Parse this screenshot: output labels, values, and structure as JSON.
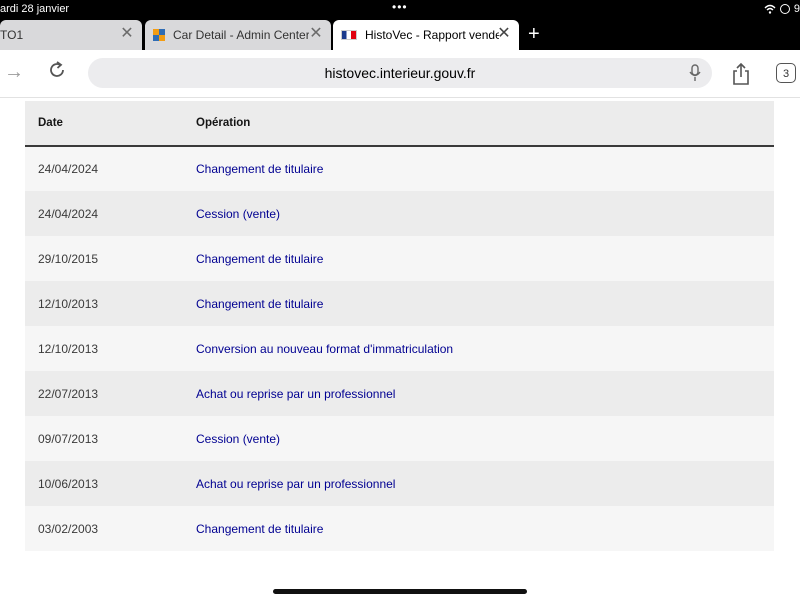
{
  "status": {
    "date": "ardi 28 janvier",
    "dots": "•••",
    "battery_partial": "9"
  },
  "tabs": [
    {
      "title": "TO1",
      "active": false
    },
    {
      "title": "Car Detail - Admin Center",
      "active": false
    },
    {
      "title": "HistoVec - Rapport vendeur",
      "active": true
    }
  ],
  "new_tab_label": "+",
  "close_symbol": "✕",
  "address_bar": {
    "url": "histovec.interieur.gouv.fr"
  },
  "tab_count": "3",
  "page": {
    "table": {
      "headers": {
        "date": "Date",
        "operation": "Opération"
      },
      "rows": [
        {
          "date": "24/04/2024",
          "operation": "Changement de titulaire"
        },
        {
          "date": "24/04/2024",
          "operation": "Cession (vente)"
        },
        {
          "date": "29/10/2015",
          "operation": "Changement de titulaire"
        },
        {
          "date": "12/10/2013",
          "operation": "Changement de titulaire"
        },
        {
          "date": "12/10/2013",
          "operation": "Conversion au nouveau format d'immatriculation"
        },
        {
          "date": "22/07/2013",
          "operation": "Achat ou reprise par un professionnel"
        },
        {
          "date": "09/07/2013",
          "operation": "Cession (vente)"
        },
        {
          "date": "10/06/2013",
          "operation": "Achat ou reprise par un professionnel"
        },
        {
          "date": "03/02/2003",
          "operation": "Changement de titulaire"
        }
      ]
    }
  },
  "colors": {
    "link": "#000091",
    "header_bg": "#ececec",
    "row_alt": "#f6f6f6"
  }
}
